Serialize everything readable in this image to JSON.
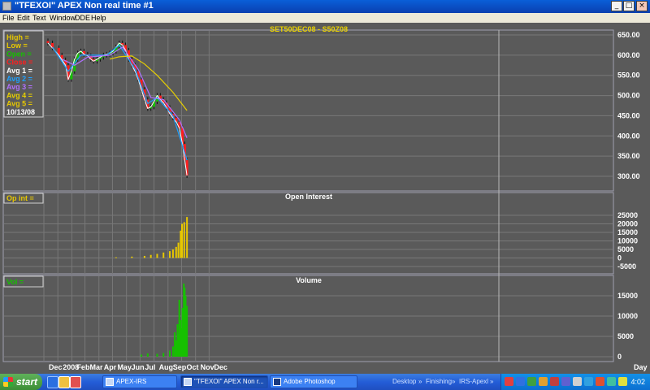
{
  "window": {
    "title": "\"TFEXOI\" APEX Non real time #1",
    "min_glyph": "_",
    "max_glyph": "□",
    "close_glyph": "×"
  },
  "menu": [
    {
      "label": "File"
    },
    {
      "label": "Edit"
    },
    {
      "label": "Text"
    },
    {
      "label": "Window"
    },
    {
      "label": "DDE"
    },
    {
      "label": "Help"
    }
  ],
  "price_panel": {
    "title": "SET50DEC08  -  S50Z08",
    "legend": [
      {
        "label": "High",
        "suffix": "=",
        "color": "#e8c800"
      },
      {
        "label": "Low",
        "suffix": "=",
        "color": "#e8c800"
      },
      {
        "label": "Open",
        "suffix": "=",
        "color": "#16c000"
      },
      {
        "label": "Close",
        "suffix": "=",
        "color": "#ff1e1e"
      },
      {
        "label": "Avg  1",
        "suffix": "=",
        "color": "#ffffff"
      },
      {
        "label": "Avg  2",
        "suffix": "=",
        "color": "#1ea0ff"
      },
      {
        "label": "Avg  3",
        "suffix": "=",
        "color": "#b070ff"
      },
      {
        "label": "Avg  4",
        "suffix": "=",
        "color": "#e8d000"
      },
      {
        "label": "Avg  5",
        "suffix": "=",
        "color": "#e8c800"
      }
    ],
    "legend_date": "10/13/08",
    "y_ticks": [
      "650.00",
      "600.00",
      "550.00",
      "500.00",
      "450.00",
      "400.00",
      "350.00",
      "300.00"
    ]
  },
  "oi_panel": {
    "title": "Open  Interest",
    "legend_label": "Op  int  =",
    "y_ticks": [
      "25000",
      "20000",
      "15000",
      "10000",
      "5000",
      "0",
      "-5000"
    ]
  },
  "volume_panel": {
    "title": "Volume",
    "legend_label": "Vol      =",
    "y_ticks": [
      "15000",
      "10000",
      "5000",
      "0"
    ]
  },
  "x_axis": {
    "labels": [
      "Dec",
      "2008",
      "Feb",
      "Mar",
      "Apr",
      "May",
      "Jun",
      "Jul",
      "Aug",
      "Sep",
      "Oct",
      "Nov",
      "Dec",
      "Day"
    ]
  },
  "taskbar": {
    "start_label": "start",
    "tasks": [
      {
        "label": "APEX-IRS",
        "active": false
      },
      {
        "label": "\"TFEXOI\" APEX Non r...",
        "active": true
      },
      {
        "label": "Adobe Photoshop",
        "active": false
      }
    ],
    "toolbars": [
      "Desktop",
      "»",
      "Finishing",
      "»",
      "IRS-Apexl",
      "»"
    ],
    "clock": "4:02"
  },
  "chart_data": [
    {
      "type": "candlestick",
      "title": "SET50DEC08  -  S50Z08",
      "xlabel": "Day",
      "ylabel": "",
      "ylim": [
        275,
        665
      ],
      "grid": true,
      "legend_placement": "top-left",
      "x_labels": [
        "Dec",
        "2008",
        "Feb",
        "Mar",
        "Apr",
        "May",
        "Jun",
        "Jul",
        "Aug",
        "Sep",
        "Oct",
        "Nov",
        "Dec"
      ],
      "close_series": [
        {
          "date": "2007-12-10",
          "value": 630
        },
        {
          "date": "2007-12-20",
          "value": 618
        },
        {
          "date": "2008-01-03",
          "value": 600
        },
        {
          "date": "2008-01-10",
          "value": 588
        },
        {
          "date": "2008-01-18",
          "value": 575
        },
        {
          "date": "2008-01-24",
          "value": 540
        },
        {
          "date": "2008-01-31",
          "value": 560
        },
        {
          "date": "2008-02-07",
          "value": 590
        },
        {
          "date": "2008-02-14",
          "value": 605
        },
        {
          "date": "2008-02-21",
          "value": 610
        },
        {
          "date": "2008-02-28",
          "value": 602
        },
        {
          "date": "2008-03-07",
          "value": 598
        },
        {
          "date": "2008-03-14",
          "value": 590
        },
        {
          "date": "2008-03-20",
          "value": 585
        },
        {
          "date": "2008-03-28",
          "value": 590
        },
        {
          "date": "2008-04-04",
          "value": 595
        },
        {
          "date": "2008-04-11",
          "value": 600
        },
        {
          "date": "2008-04-18",
          "value": 602
        },
        {
          "date": "2008-04-25",
          "value": 605
        },
        {
          "date": "2008-05-02",
          "value": 610
        },
        {
          "date": "2008-05-09",
          "value": 620
        },
        {
          "date": "2008-05-16",
          "value": 630
        },
        {
          "date": "2008-05-23",
          "value": 625
        },
        {
          "date": "2008-05-30",
          "value": 612
        },
        {
          "date": "2008-06-06",
          "value": 590
        },
        {
          "date": "2008-06-13",
          "value": 575
        },
        {
          "date": "2008-06-20",
          "value": 560
        },
        {
          "date": "2008-06-27",
          "value": 540
        },
        {
          "date": "2008-07-04",
          "value": 515
        },
        {
          "date": "2008-07-11",
          "value": 490
        },
        {
          "date": "2008-07-18",
          "value": 468
        },
        {
          "date": "2008-07-25",
          "value": 472
        },
        {
          "date": "2008-08-01",
          "value": 485
        },
        {
          "date": "2008-08-08",
          "value": 500
        },
        {
          "date": "2008-08-15",
          "value": 490
        },
        {
          "date": "2008-08-22",
          "value": 482
        },
        {
          "date": "2008-08-29",
          "value": 470
        },
        {
          "date": "2008-09-05",
          "value": 455
        },
        {
          "date": "2008-09-12",
          "value": 445
        },
        {
          "date": "2008-09-19",
          "value": 435
        },
        {
          "date": "2008-09-26",
          "value": 420
        },
        {
          "date": "2008-10-03",
          "value": 380
        },
        {
          "date": "2008-10-08",
          "value": 340
        },
        {
          "date": "2008-10-13",
          "value": 302
        }
      ],
      "averages": [
        {
          "name": "Avg 2",
          "color": "#1ea0ff",
          "values": [
            {
              "date": "2007-12-20",
              "value": 620
            },
            {
              "date": "2008-01-24",
              "value": 560
            },
            {
              "date": "2008-02-21",
              "value": 600
            },
            {
              "date": "2008-04-18",
              "value": 600
            },
            {
              "date": "2008-05-16",
              "value": 625
            },
            {
              "date": "2008-06-20",
              "value": 565
            },
            {
              "date": "2008-07-18",
              "value": 480
            },
            {
              "date": "2008-08-08",
              "value": 495
            },
            {
              "date": "2008-09-12",
              "value": 450
            },
            {
              "date": "2008-10-13",
              "value": 340
            }
          ]
        },
        {
          "name": "Avg 3",
          "color": "#b070ff",
          "values": [
            {
              "date": "2008-01-10",
              "value": 590
            },
            {
              "date": "2008-02-07",
              "value": 575
            },
            {
              "date": "2008-03-07",
              "value": 595
            },
            {
              "date": "2008-04-25",
              "value": 600
            },
            {
              "date": "2008-05-23",
              "value": 620
            },
            {
              "date": "2008-06-27",
              "value": 565
            },
            {
              "date": "2008-07-25",
              "value": 495
            },
            {
              "date": "2008-08-22",
              "value": 490
            },
            {
              "date": "2008-09-26",
              "value": 440
            },
            {
              "date": "2008-10-13",
              "value": 395
            }
          ]
        },
        {
          "name": "Avg 4",
          "color": "#e8d000",
          "values": [
            {
              "date": "2008-04-25",
              "value": 590
            },
            {
              "date": "2008-05-16",
              "value": 596
            },
            {
              "date": "2008-06-13",
              "value": 598
            },
            {
              "date": "2008-07-11",
              "value": 578
            },
            {
              "date": "2008-08-08",
              "value": 550
            },
            {
              "date": "2008-09-12",
              "value": 508
            },
            {
              "date": "2008-10-13",
              "value": 463
            }
          ]
        }
      ]
    },
    {
      "type": "bar",
      "title": "Open  Interest",
      "xlabel": "Day",
      "ylabel": "",
      "ylim": [
        -7000,
        28000
      ],
      "grid": true,
      "series": [
        {
          "values": [
            {
              "date": "2008-05-09",
              "value": 400
            },
            {
              "date": "2008-06-13",
              "value": 800
            },
            {
              "date": "2008-07-11",
              "value": 1200
            },
            {
              "date": "2008-07-25",
              "value": 1800
            },
            {
              "date": "2008-08-08",
              "value": 2400
            },
            {
              "date": "2008-08-22",
              "value": 3200
            },
            {
              "date": "2008-09-05",
              "value": 4000
            },
            {
              "date": "2008-09-12",
              "value": 5000
            },
            {
              "date": "2008-09-19",
              "value": 6500
            },
            {
              "date": "2008-09-24",
              "value": 9000
            },
            {
              "date": "2008-09-29",
              "value": 16000
            },
            {
              "date": "2008-10-02",
              "value": 20000
            },
            {
              "date": "2008-10-07",
              "value": 21000
            },
            {
              "date": "2008-10-13",
              "value": 24000
            }
          ]
        }
      ]
    },
    {
      "type": "bar",
      "title": "Volume",
      "xlabel": "Day",
      "ylabel": "",
      "ylim": [
        -1000,
        19000
      ],
      "grid": true,
      "series": [
        {
          "values": [
            {
              "date": "2008-07-04",
              "value": 500
            },
            {
              "date": "2008-07-18",
              "value": 800
            },
            {
              "date": "2008-08-08",
              "value": 700
            },
            {
              "date": "2008-08-22",
              "value": 900
            },
            {
              "date": "2008-09-05",
              "value": 1500
            },
            {
              "date": "2008-09-12",
              "value": 2500
            },
            {
              "date": "2008-09-16",
              "value": 6000
            },
            {
              "date": "2008-09-19",
              "value": 4000
            },
            {
              "date": "2008-09-22",
              "value": 8000
            },
            {
              "date": "2008-09-24",
              "value": 5500
            },
            {
              "date": "2008-09-26",
              "value": 14000
            },
            {
              "date": "2008-09-29",
              "value": 9000
            },
            {
              "date": "2008-10-01",
              "value": 7000
            },
            {
              "date": "2008-10-03",
              "value": 12000
            },
            {
              "date": "2008-10-06",
              "value": 18000
            },
            {
              "date": "2008-10-08",
              "value": 17000
            },
            {
              "date": "2008-10-10",
              "value": 15000
            },
            {
              "date": "2008-10-13",
              "value": 12500
            }
          ]
        }
      ]
    }
  ]
}
